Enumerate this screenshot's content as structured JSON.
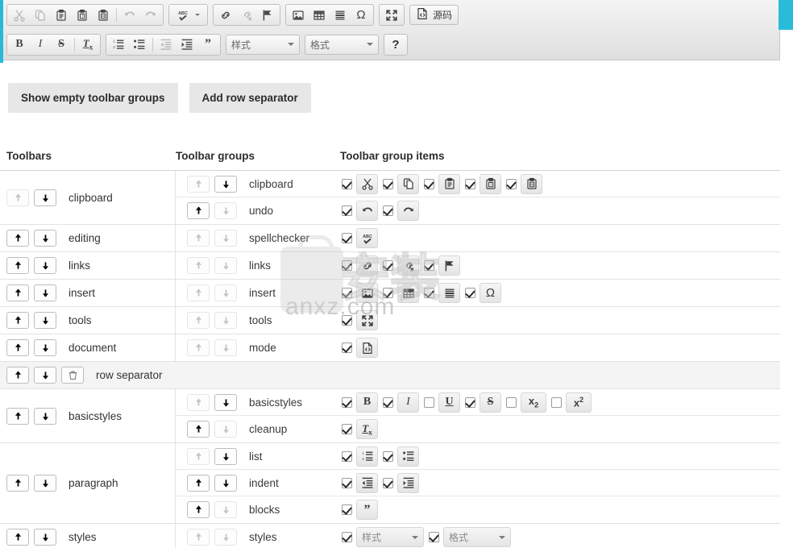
{
  "accent_color": "#29bcd8",
  "editor": {
    "row1": [
      {
        "type": "group",
        "name": "clipboard-undo",
        "buttons": [
          {
            "icon": "cut-icon",
            "disabled": true
          },
          {
            "icon": "copy-icon",
            "disabled": true
          },
          {
            "icon": "paste-icon",
            "disabled": false
          },
          {
            "icon": "paste-text-icon",
            "disabled": false
          },
          {
            "icon": "paste-word-icon",
            "disabled": false
          },
          {
            "icon": "separator",
            "disabled": false
          },
          {
            "icon": "undo-icon",
            "disabled": true
          },
          {
            "icon": "redo-icon",
            "disabled": true
          }
        ]
      },
      {
        "type": "group",
        "name": "spellchecker",
        "buttons": [
          {
            "icon": "spellchecker-icon",
            "disabled": false,
            "caret": true
          }
        ]
      },
      {
        "type": "group",
        "name": "links",
        "buttons": [
          {
            "icon": "link-icon",
            "disabled": false
          },
          {
            "icon": "unlink-icon",
            "disabled": true
          },
          {
            "icon": "anchor-icon",
            "disabled": false
          }
        ]
      },
      {
        "type": "group",
        "name": "insert",
        "buttons": [
          {
            "icon": "image-icon",
            "disabled": false
          },
          {
            "icon": "table-icon",
            "disabled": false
          },
          {
            "icon": "horizontal-rule-icon",
            "disabled": false
          },
          {
            "icon": "special-char-icon",
            "disabled": false
          }
        ]
      },
      {
        "type": "group",
        "name": "tools",
        "buttons": [
          {
            "icon": "maximize-icon",
            "disabled": false
          }
        ]
      },
      {
        "type": "source",
        "name": "source-button",
        "label": "源码",
        "icon": "source-icon"
      }
    ],
    "row2": [
      {
        "type": "group",
        "name": "basicstyles",
        "buttons": [
          {
            "icon": "bold-icon",
            "disabled": false
          },
          {
            "icon": "italic-icon",
            "disabled": false
          },
          {
            "icon": "strike-icon",
            "disabled": false
          },
          {
            "icon": "separator",
            "disabled": false
          },
          {
            "icon": "remove-format-icon",
            "disabled": false
          }
        ]
      },
      {
        "type": "group",
        "name": "paragraph",
        "buttons": [
          {
            "icon": "numbered-list-icon",
            "disabled": false
          },
          {
            "icon": "bulleted-list-icon",
            "disabled": false
          },
          {
            "icon": "separator",
            "disabled": false
          },
          {
            "icon": "outdent-icon",
            "disabled": true
          },
          {
            "icon": "indent-icon",
            "disabled": false
          },
          {
            "icon": "blockquote-icon",
            "disabled": false
          }
        ]
      },
      {
        "type": "combo",
        "name": "styles-combo",
        "label": "样式"
      },
      {
        "type": "combo",
        "name": "format-combo",
        "label": "格式"
      },
      {
        "type": "help",
        "name": "help-button",
        "label": "?"
      }
    ]
  },
  "actions": {
    "show_empty": "Show empty toolbar groups",
    "add_separator": "Add row separator"
  },
  "table": {
    "headers": {
      "toolbars": "Toolbars",
      "groups": "Toolbar groups",
      "items": "Toolbar group items"
    },
    "rows": [
      {
        "toolbar": "clipboard",
        "up_enabled": false,
        "down_enabled": true,
        "groups": [
          {
            "name": "clipboard",
            "up_enabled": false,
            "down_enabled": true,
            "items": [
              {
                "icon": "cut-icon",
                "checked": true
              },
              {
                "icon": "copy-icon",
                "checked": true
              },
              {
                "icon": "paste-icon",
                "checked": true
              },
              {
                "icon": "paste-text-icon",
                "checked": true
              },
              {
                "icon": "paste-word-icon",
                "checked": true
              }
            ]
          },
          {
            "name": "undo",
            "up_enabled": true,
            "down_enabled": false,
            "items": [
              {
                "icon": "undo-icon",
                "checked": true
              },
              {
                "icon": "redo-icon",
                "checked": true
              }
            ]
          }
        ]
      },
      {
        "toolbar": "editing",
        "up_enabled": true,
        "down_enabled": true,
        "groups": [
          {
            "name": "spellchecker",
            "up_enabled": false,
            "down_enabled": false,
            "items": [
              {
                "icon": "spellchecker-icon",
                "checked": true
              }
            ]
          }
        ]
      },
      {
        "toolbar": "links",
        "up_enabled": true,
        "down_enabled": true,
        "groups": [
          {
            "name": "links",
            "up_enabled": false,
            "down_enabled": false,
            "items": [
              {
                "icon": "link-icon",
                "checked": true
              },
              {
                "icon": "unlink-icon",
                "checked": true
              },
              {
                "icon": "anchor-icon",
                "checked": true
              }
            ]
          }
        ]
      },
      {
        "toolbar": "insert",
        "up_enabled": true,
        "down_enabled": true,
        "groups": [
          {
            "name": "insert",
            "up_enabled": false,
            "down_enabled": false,
            "items": [
              {
                "icon": "image-icon",
                "checked": true
              },
              {
                "icon": "table-icon",
                "checked": true
              },
              {
                "icon": "horizontal-rule-icon",
                "checked": true
              },
              {
                "icon": "special-char-icon",
                "checked": true
              }
            ]
          }
        ]
      },
      {
        "toolbar": "tools",
        "up_enabled": true,
        "down_enabled": true,
        "groups": [
          {
            "name": "tools",
            "up_enabled": false,
            "down_enabled": false,
            "items": [
              {
                "icon": "maximize-icon",
                "checked": true
              }
            ]
          }
        ]
      },
      {
        "toolbar": "document",
        "up_enabled": true,
        "down_enabled": true,
        "groups": [
          {
            "name": "mode",
            "up_enabled": false,
            "down_enabled": false,
            "items": [
              {
                "icon": "source-icon",
                "checked": true
              }
            ]
          }
        ]
      },
      {
        "separator": true,
        "toolbar": "row separator",
        "up_enabled": true,
        "down_enabled": true,
        "deletable": true
      },
      {
        "toolbar": "basicstyles",
        "up_enabled": true,
        "down_enabled": true,
        "groups": [
          {
            "name": "basicstyles",
            "up_enabled": false,
            "down_enabled": true,
            "items": [
              {
                "icon": "bold-icon",
                "checked": true
              },
              {
                "icon": "italic-icon",
                "checked": true
              },
              {
                "icon": "underline-icon",
                "checked": false
              },
              {
                "icon": "strike-icon",
                "checked": true
              },
              {
                "icon": "subscript-icon",
                "checked": false
              },
              {
                "icon": "superscript-icon",
                "checked": false
              }
            ]
          },
          {
            "name": "cleanup",
            "up_enabled": true,
            "down_enabled": false,
            "items": [
              {
                "icon": "remove-format-icon",
                "checked": true
              }
            ]
          }
        ]
      },
      {
        "toolbar": "paragraph",
        "up_enabled": true,
        "down_enabled": true,
        "groups": [
          {
            "name": "list",
            "up_enabled": false,
            "down_enabled": true,
            "items": [
              {
                "icon": "numbered-list-icon",
                "checked": true
              },
              {
                "icon": "bulleted-list-icon",
                "checked": true
              }
            ]
          },
          {
            "name": "indent",
            "up_enabled": true,
            "down_enabled": true,
            "items": [
              {
                "icon": "outdent-icon",
                "checked": true
              },
              {
                "icon": "indent-icon",
                "checked": true
              }
            ]
          },
          {
            "name": "blocks",
            "up_enabled": true,
            "down_enabled": false,
            "items": [
              {
                "icon": "blockquote-icon",
                "checked": true
              }
            ]
          }
        ]
      },
      {
        "toolbar": "styles",
        "up_enabled": true,
        "down_enabled": true,
        "groups": [
          {
            "name": "styles",
            "up_enabled": false,
            "down_enabled": false,
            "items": [
              {
                "icon": "styles-combo",
                "label": "样式",
                "checked": true
              },
              {
                "icon": "format-combo",
                "label": "格式",
                "checked": true
              }
            ]
          }
        ]
      }
    ]
  },
  "watermark": {
    "text": "anxz.com",
    "cn": "安装"
  }
}
